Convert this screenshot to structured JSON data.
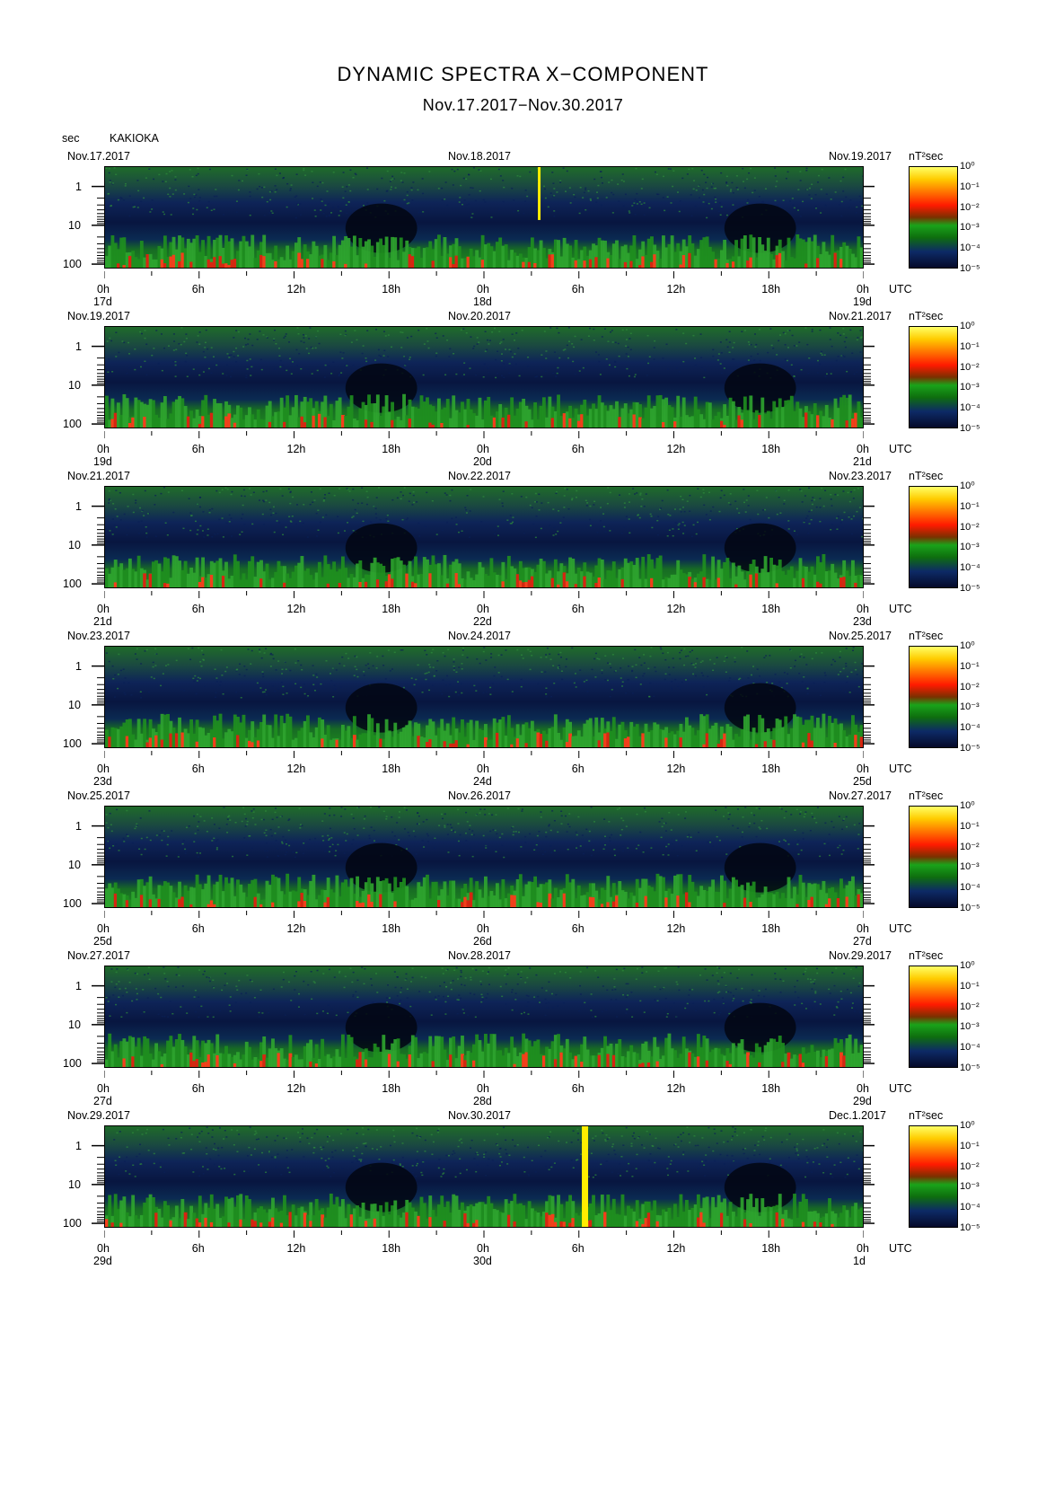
{
  "title": "DYNAMIC SPECTRA X−COMPONENT",
  "subtitle": "Nov.17.2017−Nov.30.2017",
  "yaxis_unit": "sec",
  "station": "KAKIOKA",
  "colorbar_unit": "nT²sec",
  "timezone_label": "UTC",
  "chart_data": {
    "type": "heatmap",
    "title": "DYNAMIC SPECTRA X−COMPONENT",
    "subtitle": "Nov.17.2017−Nov.30.2017",
    "station": "KAKIOKA",
    "ylabel": "sec",
    "y_scale": "log",
    "y_ticks": [
      "1",
      "10",
      "100"
    ],
    "x_ticks": [
      "0h",
      "6h",
      "12h",
      "18h",
      "0h",
      "6h",
      "12h",
      "18h",
      "0h"
    ],
    "colorbar_label": "nT²sec",
    "colorbar_ticks": [
      "10⁰",
      "10⁻¹",
      "10⁻²",
      "10⁻³",
      "10⁻⁴",
      "10⁻⁵"
    ],
    "colorbar_range": [
      1e-05,
      1
    ],
    "panels": [
      {
        "left_date": "Nov.17.2017",
        "mid_date": "Nov.18.2017",
        "right_date": "Nov.19.2017",
        "day_labels": [
          "17d",
          "18d",
          "19d"
        ],
        "bursts_hours": [
          27.5
        ]
      },
      {
        "left_date": "Nov.19.2017",
        "mid_date": "Nov.20.2017",
        "right_date": "Nov.21.2017",
        "day_labels": [
          "19d",
          "20d",
          "21d"
        ],
        "bursts_hours": []
      },
      {
        "left_date": "Nov.21.2017",
        "mid_date": "Nov.22.2017",
        "right_date": "Nov.23.2017",
        "day_labels": [
          "21d",
          "22d",
          "23d"
        ],
        "bursts_hours": []
      },
      {
        "left_date": "Nov.23.2017",
        "mid_date": "Nov.24.2017",
        "right_date": "Nov.25.2017",
        "day_labels": [
          "23d",
          "24d",
          "25d"
        ],
        "bursts_hours": []
      },
      {
        "left_date": "Nov.25.2017",
        "mid_date": "Nov.26.2017",
        "right_date": "Nov.27.2017",
        "day_labels": [
          "25d",
          "26d",
          "27d"
        ],
        "bursts_hours": []
      },
      {
        "left_date": "Nov.27.2017",
        "mid_date": "Nov.28.2017",
        "right_date": "Nov.29.2017",
        "day_labels": [
          "27d",
          "28d",
          "29d"
        ],
        "bursts_hours": []
      },
      {
        "left_date": "Nov.29.2017",
        "mid_date": "Nov.30.2017",
        "right_date": "Dec.1.2017",
        "day_labels": [
          "29d",
          "30d",
          "1d"
        ],
        "bursts_hours": [
          30.4
        ]
      }
    ]
  }
}
